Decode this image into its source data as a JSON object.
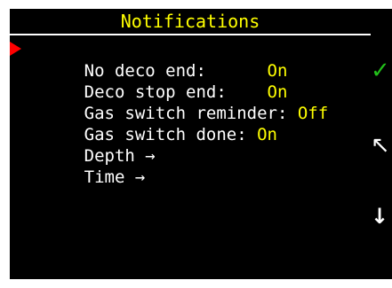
{
  "header": {
    "title": "Notifications"
  },
  "menu": {
    "items": [
      {
        "label": "No deco end:      ",
        "value": "On",
        "selected": true
      },
      {
        "label": "Deco stop end:    ",
        "value": "On",
        "selected": false
      },
      {
        "label": "Gas switch reminder: ",
        "value": "Off",
        "selected": false
      },
      {
        "label": "Gas switch done: ",
        "value": "On",
        "selected": false
      },
      {
        "label": "Depth →",
        "value": "",
        "selected": false
      },
      {
        "label": "Time →",
        "value": "",
        "selected": false
      }
    ]
  },
  "sidebar": {
    "confirm_icon": "✓",
    "back_icon": "↖",
    "next_icon": "↓"
  },
  "colors": {
    "background": "#000000",
    "title": "#ffff00",
    "label": "#ffffff",
    "value": "#ffff00",
    "cursor": "#ff0000",
    "confirm": "#22c01a"
  }
}
